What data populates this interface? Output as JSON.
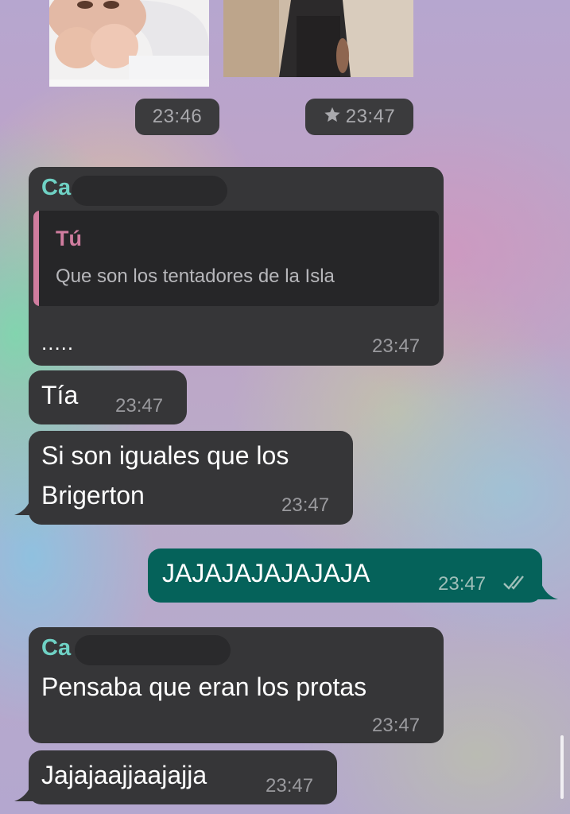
{
  "chat": {
    "media": {
      "left_time": "23:46",
      "right_time": "23:47",
      "right_star_icon": "star-icon"
    },
    "messages": [
      {
        "sender": "Ca",
        "quote_author": "Tú",
        "quote_text": "Que son los tentadores de la Isla",
        "text": ".....",
        "time": "23:47"
      },
      {
        "text": "Tía",
        "time": "23:47"
      },
      {
        "text_line1": "Si son iguales que los",
        "text_line2": "Brigerton",
        "time": "23:47"
      },
      {
        "text": "JAJAJAJAJAJAJA",
        "time": "23:47",
        "status_icon": "double-check-icon"
      },
      {
        "sender": "Ca",
        "text": "Pensaba que eran los protas",
        "time": "23:47"
      },
      {
        "text": "Jajajaajjaajajja",
        "time": "23:47"
      }
    ],
    "colors": {
      "incoming_bubble": "#363638",
      "outgoing_bubble": "#05625a",
      "sender_name": "#6fd1c4",
      "quote_accent": "#d07d9f"
    }
  }
}
